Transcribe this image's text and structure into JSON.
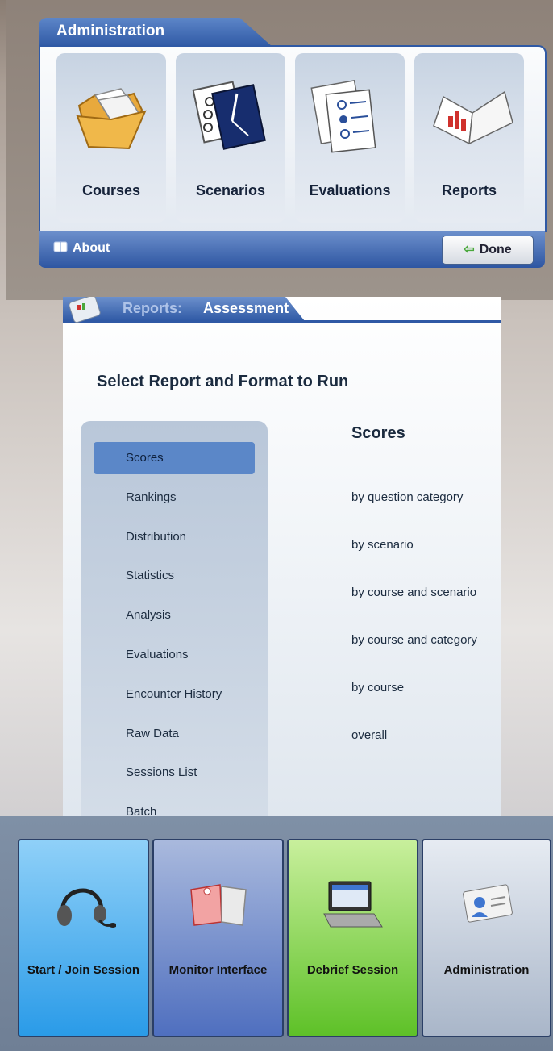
{
  "admin": {
    "title": "Administration",
    "tiles": [
      {
        "label": "Courses",
        "icon": "folder-icon"
      },
      {
        "label": "Scenarios",
        "icon": "scenario-clock-icon"
      },
      {
        "label": "Evaluations",
        "icon": "evaluation-form-icon"
      },
      {
        "label": "Reports",
        "icon": "report-book-icon"
      }
    ],
    "about_label": "About",
    "done_label": "Done"
  },
  "reports": {
    "breadcrumb_section": "Reports:",
    "breadcrumb_page": "Assessment",
    "heading": "Select Report and Format to Run",
    "report_types": [
      "Scores",
      "Rankings",
      "Distribution",
      "Statistics",
      "Analysis",
      "Evaluations",
      "Encounter History",
      "Raw Data",
      "Sessions List",
      "Batch"
    ],
    "selected_report": "Scores",
    "formats_title": "Scores",
    "formats": [
      "by question category",
      "by scenario",
      "by course and scenario",
      "by course and category",
      "by course",
      "overall"
    ]
  },
  "nav": {
    "buttons": [
      {
        "label": "Start / Join Session",
        "color": "#3fa7ec"
      },
      {
        "label": "Monitor Interface",
        "color": "#5b78c2"
      },
      {
        "label": "Debrief Session",
        "color": "#72c83a"
      },
      {
        "label": "Administration",
        "color": "#a9b6c9"
      }
    ]
  }
}
